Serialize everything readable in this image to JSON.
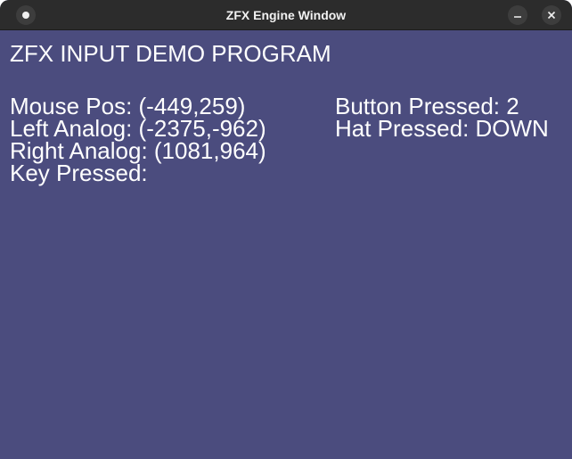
{
  "window": {
    "title": "ZFX Engine Window",
    "controls": {
      "menu_icon": "circle-menu-icon",
      "minimize_icon": "minimize-icon",
      "close_icon": "close-icon"
    },
    "colors": {
      "titlebar": "#2c2c2c",
      "background": "#4b4c7e",
      "text": "#ffffff"
    }
  },
  "demo": {
    "heading": "ZFX INPUT DEMO PROGRAM",
    "left": {
      "mouse_pos": "Mouse Pos: (-449,259)",
      "left_analog": "Left Analog: (-2375,-962)",
      "right_analog": "Right Analog: (1081,964)",
      "key_pressed": "Key Pressed:"
    },
    "right": {
      "button_pressed": "Button Pressed: 2",
      "hat_pressed": "Hat Pressed: DOWN"
    }
  }
}
